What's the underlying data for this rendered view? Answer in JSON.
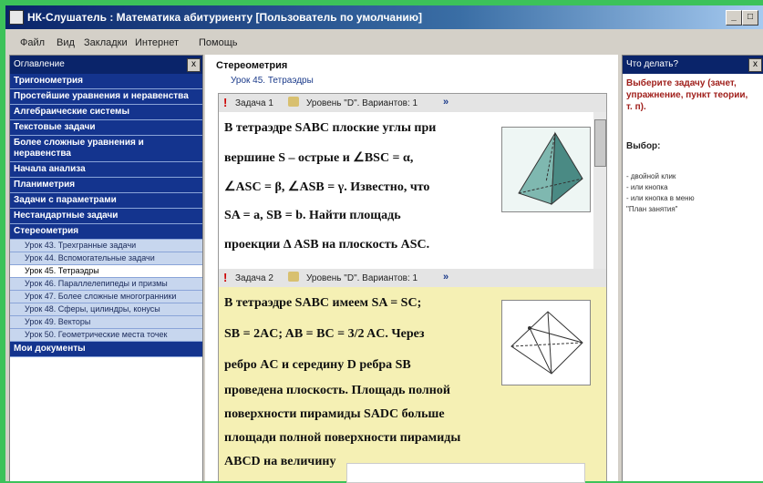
{
  "window": {
    "title": "НК-Слушатель : Математика абитуриенту [Пользователь по умолчанию]"
  },
  "menu": [
    "Файл",
    "Вид",
    "Закладки",
    "Интернет",
    "Помощь"
  ],
  "left_panel": {
    "header": "Оглавление",
    "close_glyph": "x",
    "categories_top": [
      "Тригонометрия",
      "Простейшие уравнения и неравенства",
      "Алгебраические системы",
      "Текстовые задачи",
      "Более сложные уравнения и неравенства",
      "Начала анализа",
      "Планиметрия",
      "Задачи с параметрами",
      "Нестандартные задачи",
      "Стереометрия"
    ],
    "lessons": [
      "Урок 43. Трехгранные задачи",
      "Урок 44. Вспомогательные задачи",
      "Урок 45. Тетраэдры",
      "Урок 46. Параллелепипеды и призмы",
      "Урок 47. Более сложные многогранники",
      "Урок 48. Сферы, цилиндры, конусы",
      "Урок 49. Векторы",
      "Урок 50. Геометрические места точек"
    ],
    "selected_lesson": "Урок 45. Тетраэдры",
    "bottom_category": "Мои документы"
  },
  "center": {
    "section": "Стереометрия",
    "lesson": "Урок 45. Тетраэдры",
    "task1": {
      "label": "Задача 1",
      "level": "Уровень \"D\". Вариантов: 1",
      "lines": [
        "В тетраэдре SABC плоские углы при",
        "вершине S – острые и ∠BSC = α,",
        "∠ASC = β, ∠ASB = γ. Известно, что",
        "SA = a, SB = b. Найти площадь",
        "проекции Δ ASB на плоскость ASC."
      ]
    },
    "task2": {
      "label": "Задача 2",
      "level": "Уровень \"D\". Вариантов: 1",
      "lines": [
        "В тетраэдре SABC имеем SA = SC;",
        "SB = 2AC; AB = BC = 3/2 AC. Через",
        "ребро AC и середину D ребра SB",
        "проведена плоскость. Площадь полной",
        "поверхности пирамиды SADC больше",
        "площади полной поверхности пирамиды",
        "ABCD на величину"
      ]
    },
    "arrows": "»"
  },
  "right_panel": {
    "header": "Что делать?",
    "close_glyph": "x",
    "instruction": "Выберите задачу (зачет, упражнение, пункт теории, т. п).",
    "choice_label": "Выбор:",
    "options": [
      "- двойной клик",
      "- или кнопка",
      "- или кнопка в меню",
      "\"План занятия\""
    ]
  }
}
